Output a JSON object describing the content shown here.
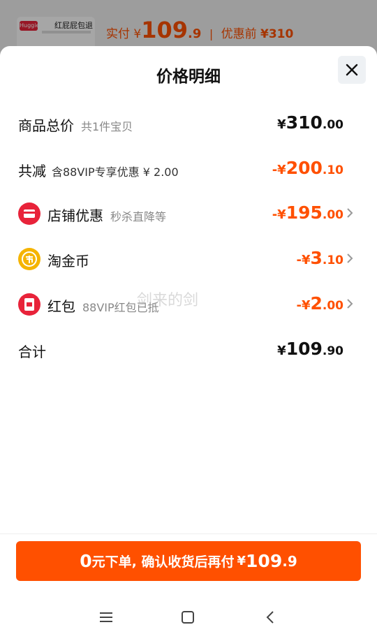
{
  "peek": {
    "product_name": "红屁屁包退",
    "thumb_brand": "Huggies",
    "paid_label": "实付",
    "yen": "¥",
    "price_int": "109",
    "price_dec": ".9",
    "separator": "|",
    "before_label": "优惠前",
    "before_price": "¥310"
  },
  "sheet": {
    "title": "价格明细"
  },
  "rows": {
    "total": {
      "label": "商品总价",
      "sub": "共1件宝贝",
      "yen": "¥",
      "int": "310",
      "dec": ".00"
    },
    "reduce": {
      "label": "共减",
      "sub": "含88VIP专享优惠 ¥ 2.00",
      "yen": "-¥",
      "int": "200",
      "dec": ".10"
    },
    "shop": {
      "label": "店铺优惠",
      "sub": "秒杀直降等",
      "yen": "-¥",
      "int": "195",
      "dec": ".00"
    },
    "coin": {
      "label": "淘金币",
      "yen": "-¥",
      "int": "3",
      "dec": ".10"
    },
    "redpacket": {
      "label": "红包",
      "sub": "88VIP红包已抵",
      "yen": "-¥",
      "int": "2",
      "dec": ".00"
    },
    "sum": {
      "label": "合计",
      "yen": "¥",
      "int": "109",
      "dec": ".90"
    }
  },
  "pay": {
    "zero": "0",
    "text": "元下单, 确认收货后再付",
    "yen": "¥",
    "int": "109",
    "dec": ".9"
  },
  "watermark": "剑来的剑",
  "colors": {
    "accent": "#ff5000",
    "icon_red": "#e8233a",
    "coin_yellow": "#f5b400"
  }
}
